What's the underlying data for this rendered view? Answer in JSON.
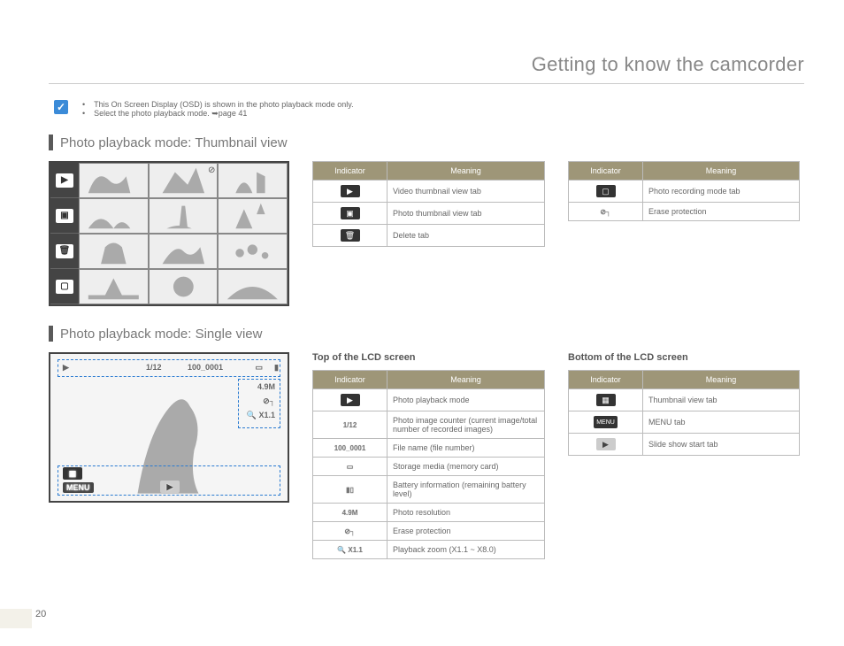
{
  "page": {
    "number": "20",
    "title": "Getting to know the camcorder"
  },
  "notes": {
    "line1": "This On Screen Display (OSD) is shown in the photo playback mode only.",
    "line2_a": "Select the photo playback mode. ",
    "line2_b": "page 41"
  },
  "section1": {
    "heading": "Photo playback mode: Thumbnail view",
    "table_left": {
      "h1": "Indicator",
      "h2": "Meaning",
      "rows": [
        {
          "meaning": "Video thumbnail view tab"
        },
        {
          "meaning": "Photo thumbnail view tab"
        },
        {
          "meaning": "Delete tab"
        }
      ]
    },
    "table_right": {
      "h1": "Indicator",
      "h2": "Meaning",
      "rows": [
        {
          "meaning": "Photo recording mode tab"
        },
        {
          "meaning": "Erase protection"
        }
      ]
    }
  },
  "section2": {
    "heading": "Photo playback mode: Single view",
    "lcd": {
      "counter": "1/12",
      "filename": "100_0001",
      "res": "4.9M",
      "zoom": "X1.1",
      "menu": "MENU"
    },
    "top": {
      "title": "Top of the LCD screen",
      "h1": "Indicator",
      "h2": "Meaning",
      "rows": [
        {
          "ind_text": "",
          "meaning": "Photo playback mode"
        },
        {
          "ind_text": "1/12",
          "meaning": "Photo image counter (current image/total number of recorded images)"
        },
        {
          "ind_text": "100_0001",
          "meaning": "File name (file number)"
        },
        {
          "ind_text": "",
          "meaning": "Storage media (memory card)"
        },
        {
          "ind_text": "",
          "meaning": "Battery information (remaining battery level)"
        },
        {
          "ind_text": "4.9M",
          "meaning": "Photo resolution"
        },
        {
          "ind_text": "",
          "meaning": "Erase protection"
        },
        {
          "ind_text": "X1.1",
          "meaning": "Playback zoom (X1.1 ~ X8.0)"
        }
      ]
    },
    "bottom": {
      "title": "Bottom of the LCD screen",
      "h1": "Indicator",
      "h2": "Meaning",
      "rows": [
        {
          "meaning": "Thumbnail view tab"
        },
        {
          "meaning": "MENU tab"
        },
        {
          "meaning": "Slide show start tab"
        }
      ]
    }
  }
}
